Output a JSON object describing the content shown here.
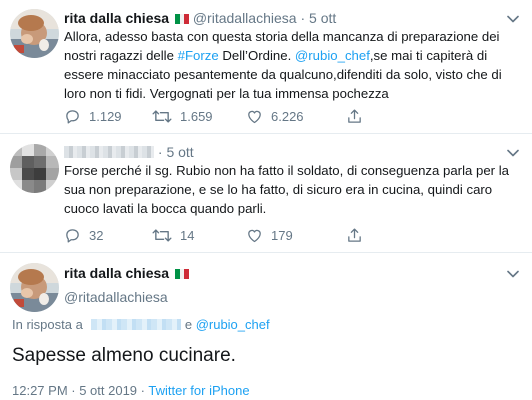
{
  "tweet1": {
    "name": "rita dalla chiesa",
    "handle": "@ritadallachiesa",
    "separator": "·",
    "time": "5 ott",
    "text_parts": [
      "Allora, adesso basta con questa storia della mancanza di preparazione dei nostri ragazzi delle ",
      "#Forze",
      " Dell’Ordine. ",
      "@rubio_chef",
      ",se mai ti capiterà di essere minacciato pesantemente da qualcuno,difenditi da solo, visto che di loro non ti fidi. Vergognati per la tua immensa pochezza"
    ],
    "replies": "1.129",
    "retweets": "1.659",
    "likes": "6.226"
  },
  "tweet2": {
    "separator": "·",
    "time": "5 ott",
    "text": "Forse perché il sg. Rubio non ha fatto il soldato, di conseguenza parla per la sua non preparazione,  e se lo ha fatto, di sicuro era in cucina, quindi caro cuoco lavati la bocca quando parli.",
    "replies": "32",
    "retweets": "14",
    "likes": "179"
  },
  "tweet3": {
    "name": "rita dalla chiesa",
    "handle": "@ritadallachiesa",
    "reply_prefix": "In risposta a",
    "reply_and": "e",
    "reply_handle": "@rubio_chef",
    "text": "Sapesse almeno cucinare.",
    "time": "12:27 PM · 5 ott 2019",
    "separator": "·",
    "source": "Twitter for iPhone"
  },
  "colors": {
    "link": "#1da1f2",
    "secondary": "#657786",
    "primary": "#14171a",
    "divider": "#e6ecf0"
  },
  "icons": [
    "reply-icon",
    "retweet-icon",
    "like-icon",
    "share-icon",
    "caret-down-icon",
    "italian-flag-icon"
  ]
}
